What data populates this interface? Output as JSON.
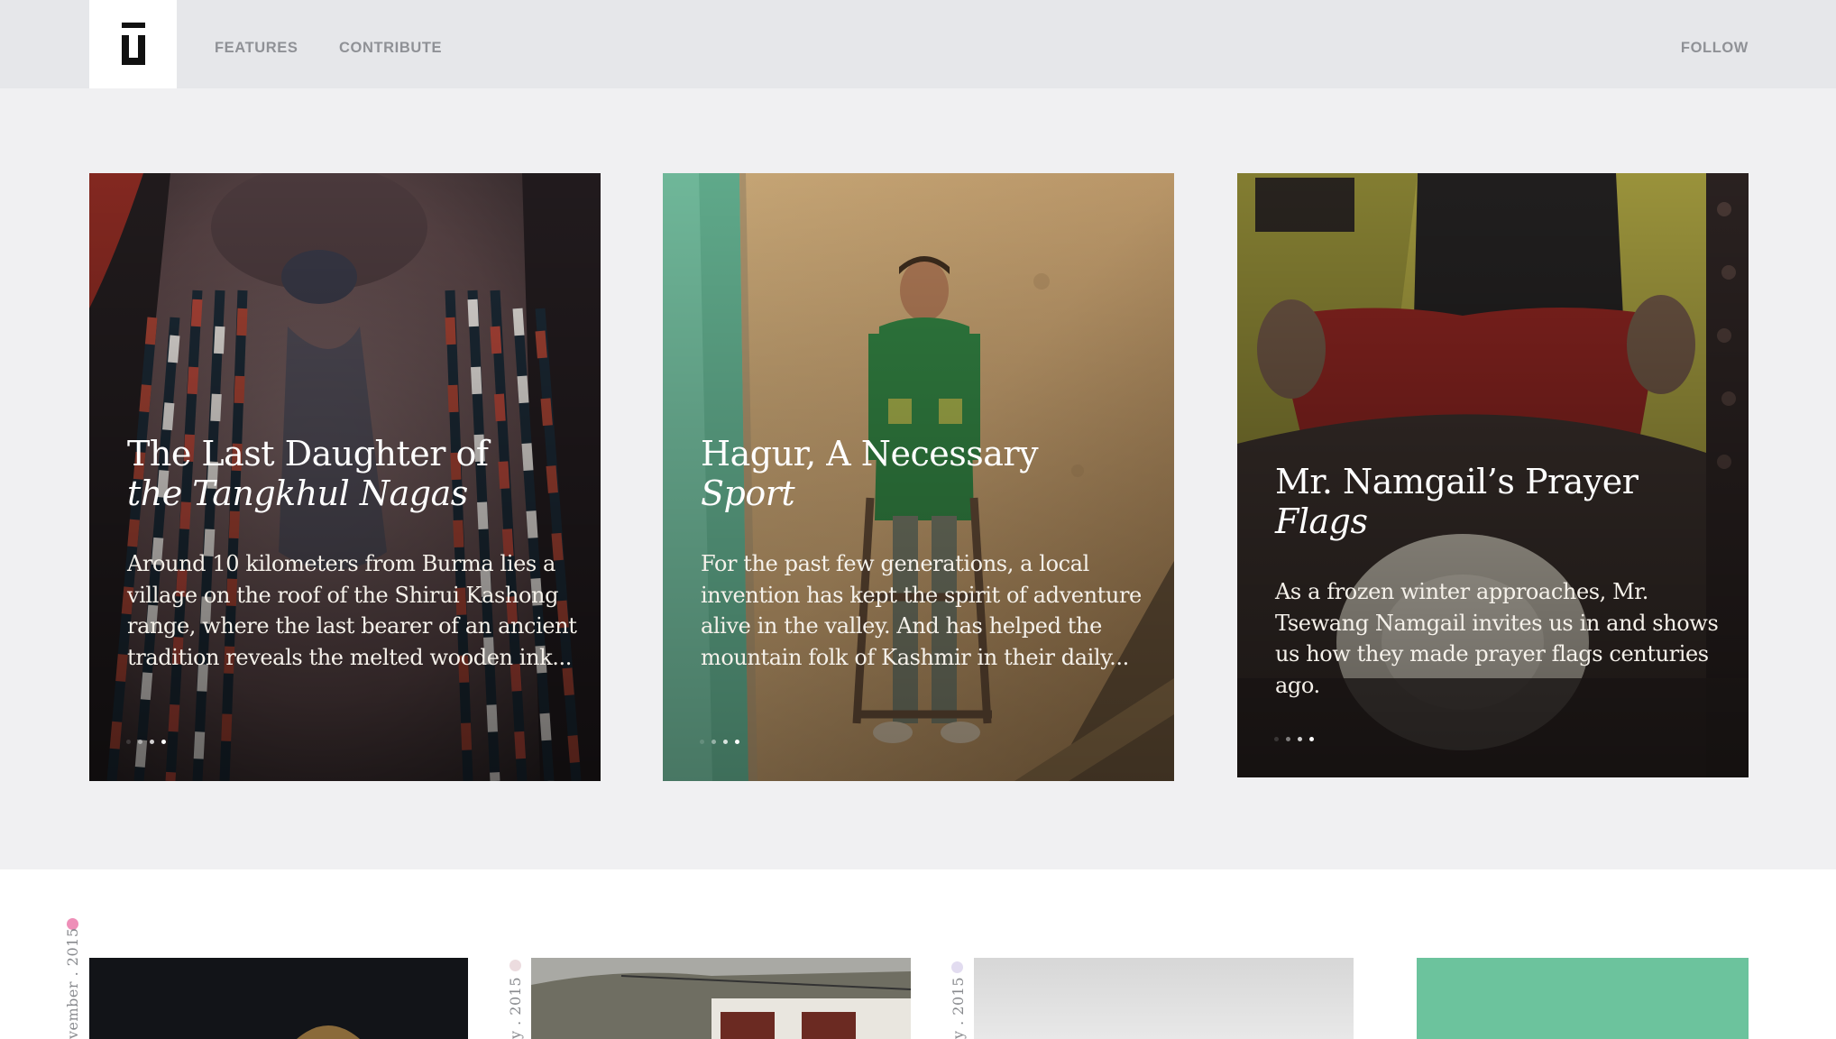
{
  "header": {
    "logo_icon": "site-logo-mark",
    "nav": [
      {
        "label": "FEATURES"
      },
      {
        "label": "CONTRIBUTE"
      }
    ],
    "follow_label": "FOLLOW"
  },
  "cards": [
    {
      "title_line1": "The Last Daughter of",
      "title_line2": "the Tangkhul Nagas",
      "excerpt": "Around 10 kilometers from Burma lies a village on the roof of the Shirui Kashong range, where the last bearer of an ancient tradition reveals the melted wooden ink...",
      "active_dot": 3
    },
    {
      "title_line1": "Hagur, A Necessary",
      "title_line2": "Sport",
      "excerpt": "For the past few generations, a local invention has kept the spirit of adventure alive in the valley. And has helped the mountain folk of Kashmir in their daily...",
      "active_dot": 3
    },
    {
      "title_line1": "Mr. Namgail’s Prayer",
      "title_line2": "Flags",
      "excerpt": "As a frozen winter approaches, Mr. Tsewang Namgail invites us in and shows us how they made prayer flags centuries ago.",
      "active_dot": 3
    }
  ],
  "posts": [
    {
      "date": "vember . 2015",
      "dot_color": "#ee8fb8"
    },
    {
      "date": "y . 2015",
      "dot_color": "#ecdcdf"
    },
    {
      "date": "y . 2015",
      "dot_color": "#e2dcf0"
    },
    {
      "date": "",
      "dot_color": "#6cc39d"
    }
  ]
}
